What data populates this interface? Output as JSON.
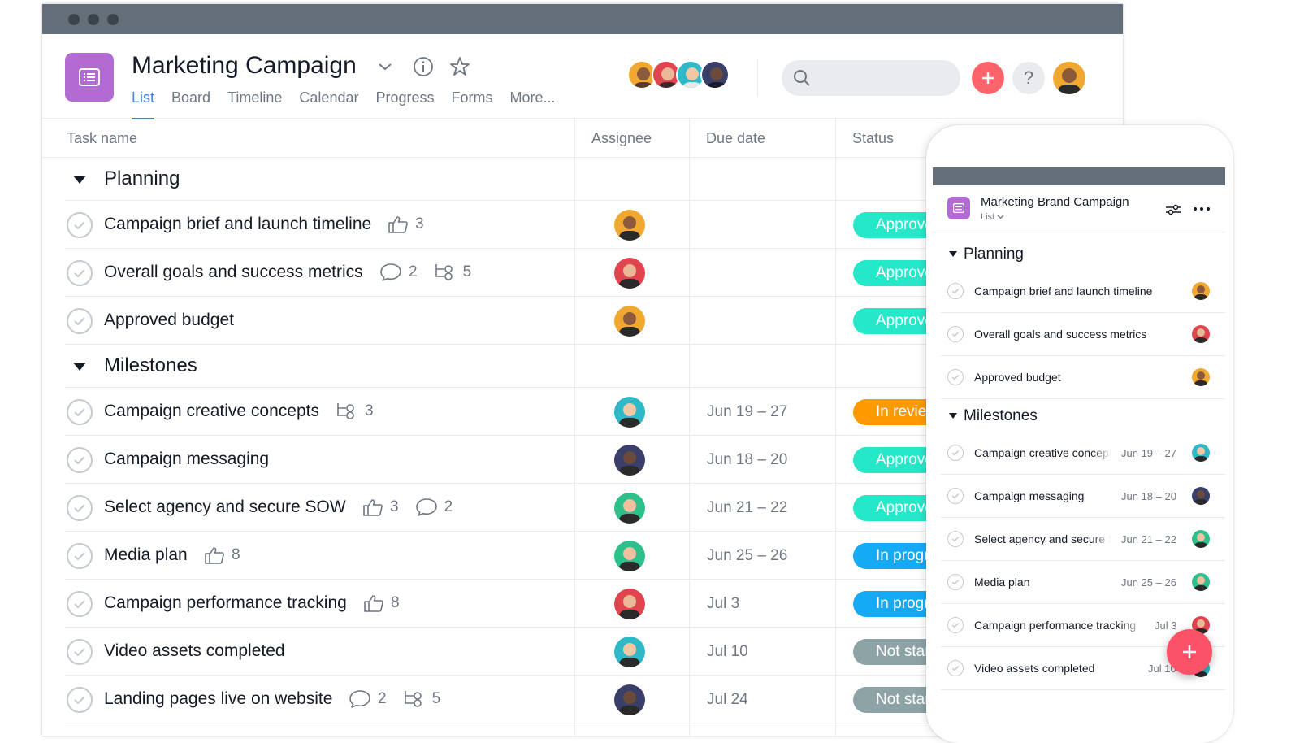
{
  "window": {
    "title_bar": ""
  },
  "project": {
    "title": "Marketing Campaign",
    "icon": "list-icon",
    "color": "#b36bd4"
  },
  "tabs": [
    {
      "label": "List",
      "active": true
    },
    {
      "label": "Board",
      "active": false
    },
    {
      "label": "Timeline",
      "active": false
    },
    {
      "label": "Calendar",
      "active": false
    },
    {
      "label": "Progress",
      "active": false
    },
    {
      "label": "Forms",
      "active": false
    },
    {
      "label": "More...",
      "active": false
    }
  ],
  "search": {
    "placeholder": ""
  },
  "columns": {
    "task": "Task name",
    "assignee": "Assignee",
    "due": "Due date",
    "status": "Status"
  },
  "sections": [
    {
      "title": "Planning",
      "tasks": [
        {
          "name": "Campaign brief and launch timeline",
          "likes": "3",
          "due": "",
          "status": "Approved",
          "status_color": "#25e8c8"
        },
        {
          "name": "Overall goals and success metrics",
          "comments": "2",
          "subtasks": "5",
          "due": "",
          "status": "Approved",
          "status_color": "#25e8c8"
        },
        {
          "name": "Approved budget",
          "due": "",
          "status": "Approved",
          "status_color": "#25e8c8"
        }
      ]
    },
    {
      "title": "Milestones",
      "tasks": [
        {
          "name": "Campaign creative concepts",
          "subtasks": "3",
          "due": "Jun 19 – 27",
          "status": "In review",
          "status_color": "#fd9a00"
        },
        {
          "name": "Campaign messaging",
          "due": "Jun 18 – 20",
          "status": "Approved",
          "status_color": "#25e8c8"
        },
        {
          "name": "Select agency and secure SOW",
          "likes": "3",
          "comments": "2",
          "due": "Jun 21 – 22",
          "status": "Approved",
          "status_color": "#25e8c8"
        },
        {
          "name": "Media plan",
          "likes": "8",
          "due": "Jun 25 – 26",
          "status": "In progress",
          "status_color": "#14aaf5"
        },
        {
          "name": "Campaign performance tracking",
          "likes": "8",
          "due": "Jul 3",
          "status": "In progress",
          "status_color": "#14aaf5"
        },
        {
          "name": "Video assets completed",
          "due": "Jul 10",
          "status": "Not started",
          "status_color": "#8da3a6"
        },
        {
          "name": "Landing pages live on website",
          "comments": "2",
          "subtasks": "5",
          "due": "Jul 24",
          "status": "Not started",
          "status_color": "#8da3a6"
        }
      ]
    }
  ],
  "mobile": {
    "title": "Marketing Brand Campaign",
    "view": "List",
    "sections": [
      {
        "title": "Planning",
        "tasks": [
          {
            "name": "Campaign brief and launch timeline",
            "due": ""
          },
          {
            "name": "Overall goals and success metrics",
            "due": ""
          },
          {
            "name": "Approved budget",
            "due": ""
          }
        ]
      },
      {
        "title": "Milestones",
        "tasks": [
          {
            "name": "Campaign creative concepts",
            "due": "Jun 19 – 27"
          },
          {
            "name": "Campaign messaging",
            "due": "Jun 18 – 20"
          },
          {
            "name": "Select agency and secure SOW",
            "due": "Jun 21 – 22"
          },
          {
            "name": "Media plan",
            "due": "Jun 25 – 26"
          },
          {
            "name": "Campaign performance tracking",
            "due": "Jul 3"
          },
          {
            "name": "Video assets completed",
            "due": "Jul 10"
          }
        ]
      }
    ]
  },
  "colors": {
    "accent": "#4186e0",
    "add": "#fc636b",
    "approved": "#25e8c8",
    "in_review": "#fd9a00",
    "in_progress": "#14aaf5",
    "not_started": "#8da3a6"
  }
}
